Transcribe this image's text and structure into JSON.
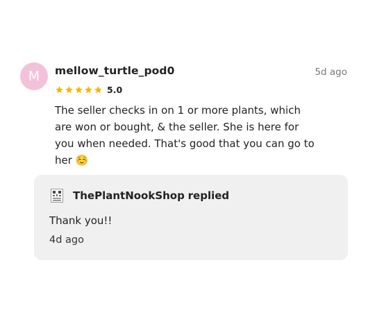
{
  "review": {
    "avatar_letter": "M",
    "username": "mellow_turtle_pod0",
    "timestamp": "5d ago",
    "rating": {
      "stars": 5,
      "max": 5,
      "value": "5.0"
    },
    "text": "The seller checks in on 1 or more plants, which are won or bought, & the seller.  She is here for you when needed.  That's good that you can go to her ☺️",
    "colors": {
      "avatar_bg": "#f2c2da",
      "star": "#f5b800"
    }
  },
  "reply": {
    "shop_name": "ThePlantNookShop",
    "replied_label": "replied",
    "logo_icon": "shop-logo-icon",
    "text": "Thank you!!",
    "timestamp": "4d ago"
  }
}
